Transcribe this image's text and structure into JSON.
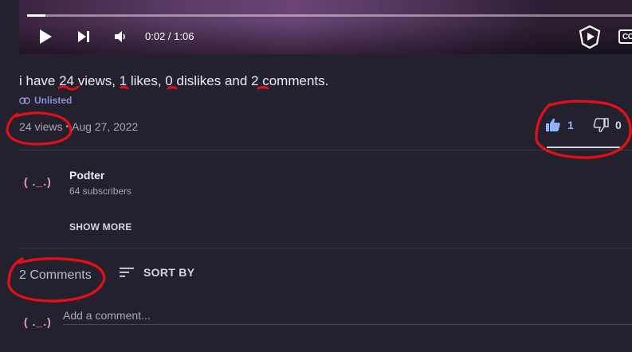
{
  "player": {
    "time_display": "0:02 / 1:06",
    "progress": 0.03,
    "cc_label": "CC"
  },
  "video": {
    "title": "i have 24 views, 1 likes, 0 dislikes and 2 comments.",
    "visibility": "Unlisted",
    "views": "24 views",
    "separator": "•",
    "date": "Aug 27, 2022",
    "likes": "1",
    "dislikes": "0"
  },
  "channel": {
    "avatar_text": "( ._.)",
    "name": "Podter",
    "subscribers": "64 subscribers",
    "show_more": "SHOW MORE"
  },
  "comments": {
    "count_label": "2 Comments",
    "sort_label": "SORT BY",
    "avatar_text": "( ._.)",
    "placeholder": "Add a comment..."
  },
  "colors": {
    "background": "#23212e",
    "accent_like": "#8fb3ff",
    "unlisted": "#8d8fd9",
    "annotation": "#e0101a"
  }
}
